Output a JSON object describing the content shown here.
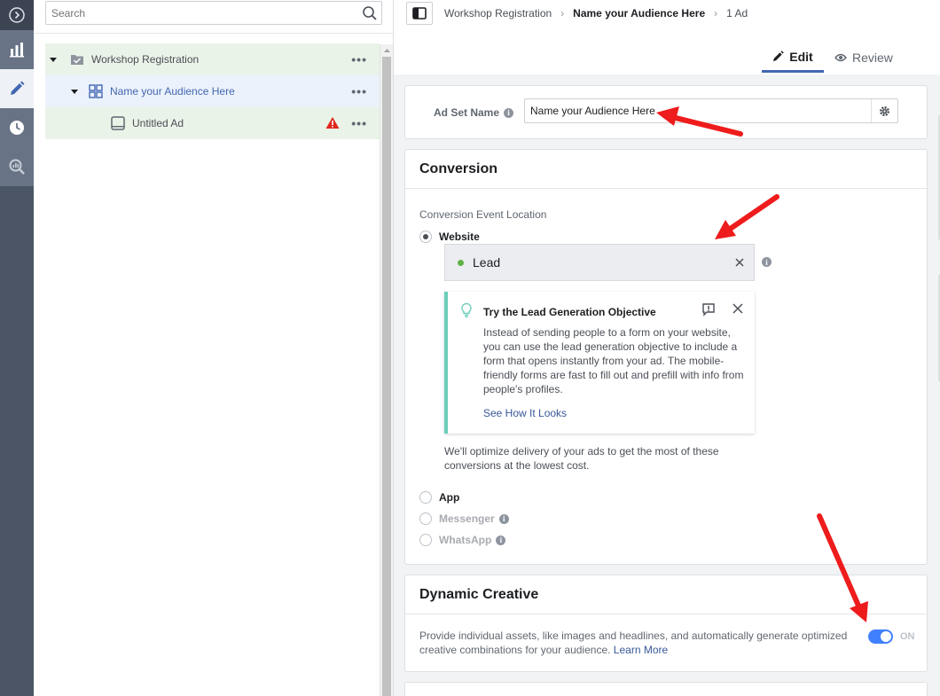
{
  "search": {
    "placeholder": "Search"
  },
  "tree": {
    "campaign": "Workshop Registration",
    "adset": "Name your Audience Here",
    "ad": "Untitled Ad",
    "more": "•••"
  },
  "breadcrumb": {
    "campaign": "Workshop Registration",
    "adset": "Name your Audience Here",
    "count": "1 Ad"
  },
  "tabs": {
    "edit": "Edit",
    "review": "Review"
  },
  "adset_name": {
    "label": "Ad Set Name",
    "value": "Name your Audience Here"
  },
  "conversion": {
    "title": "Conversion",
    "location_label": "Conversion Event Location",
    "website": "Website",
    "event": "Lead",
    "tip": {
      "title": "Try the Lead Generation Objective",
      "body": "Instead of sending people to a form on your website, you can use the lead generation objective to include a form that opens instantly from your ad. The mobile-friendly forms are fast to fill out and prefill with info from people's profiles.",
      "link": "See How It Looks"
    },
    "optimize_note": "We'll optimize delivery of your ads to get the most of these conversions at the lowest cost.",
    "app": "App",
    "messenger": "Messenger",
    "whatsapp": "WhatsApp"
  },
  "dynamic_creative": {
    "title": "Dynamic Creative",
    "body": "Provide individual assets, like images and headlines, and automatically generate optimized creative combinations for your audience.",
    "learn_more": "Learn More",
    "toggle_label": "ON"
  },
  "colors": {
    "accent": "#4267b2",
    "toggle": "#4080ff",
    "warning": "#e0251b",
    "tip_border": "#6bcebb",
    "lead_dot": "#5fb246",
    "arrow": "#ee1c1c"
  }
}
